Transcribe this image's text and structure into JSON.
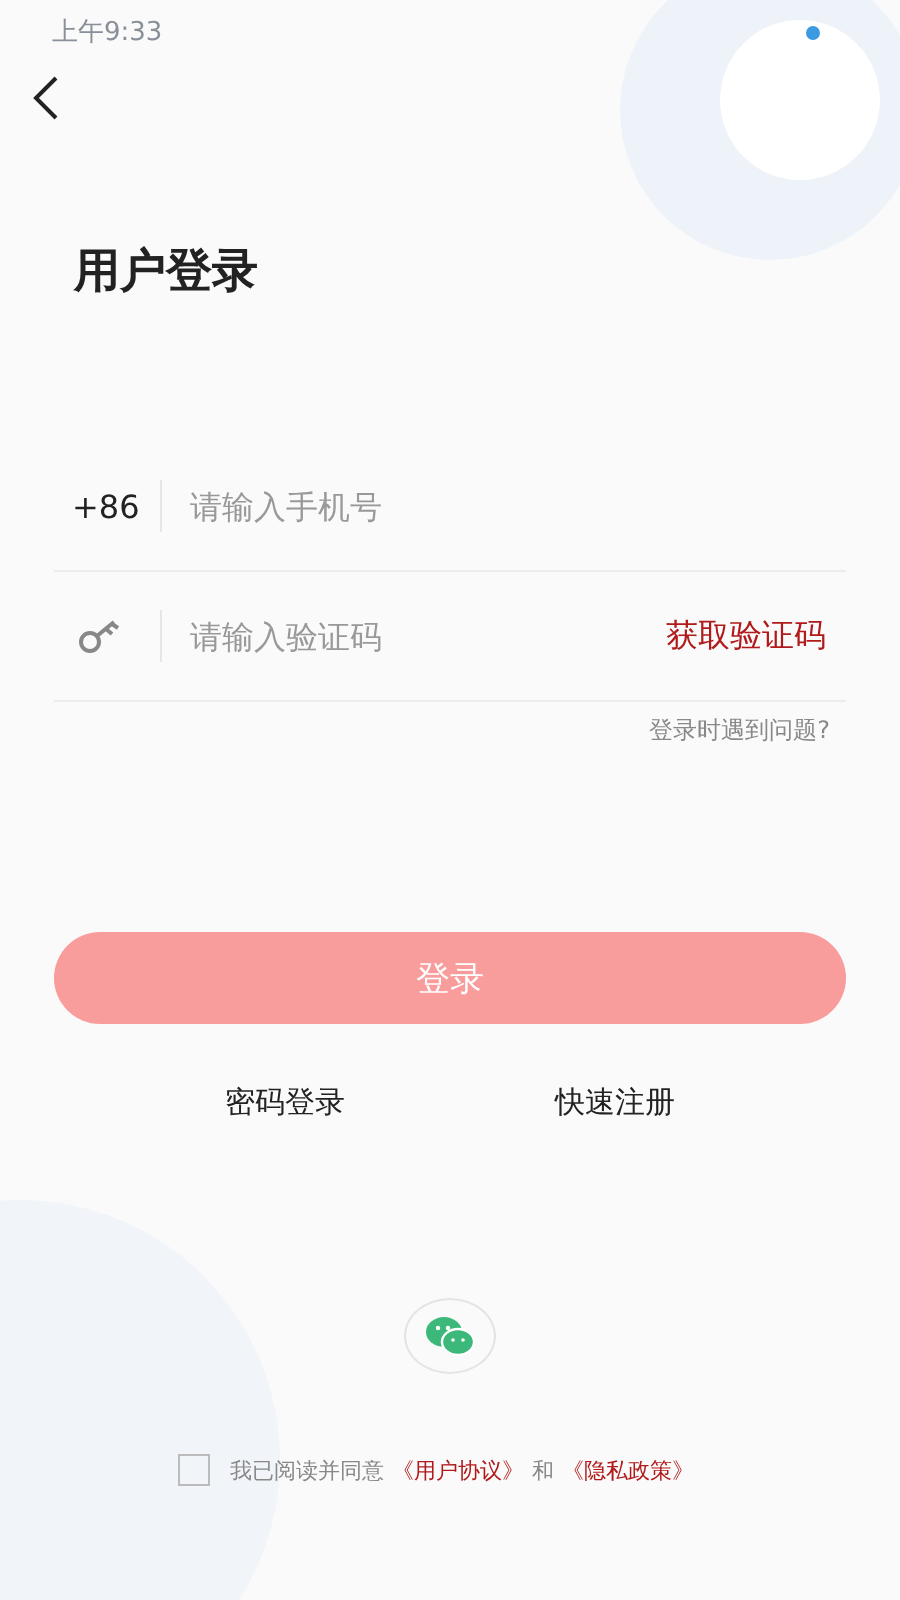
{
  "status_bar": {
    "time": "上午9:33"
  },
  "title": "用户登录",
  "phone_field": {
    "prefix": "+86",
    "placeholder": "请输入手机号"
  },
  "code_field": {
    "placeholder": "请输入验证码",
    "action": "获取验证码"
  },
  "help_link": "登录时遇到问题?",
  "login_button": {
    "label": "登录",
    "disabled": true
  },
  "alt_links": [
    "密码登录",
    "快速注册"
  ],
  "agreement": {
    "checked": false,
    "text": "我已阅读并同意",
    "link_1": "《用户协议》",
    "conjunction": "和",
    "link_2": "《隐私政策》"
  }
}
